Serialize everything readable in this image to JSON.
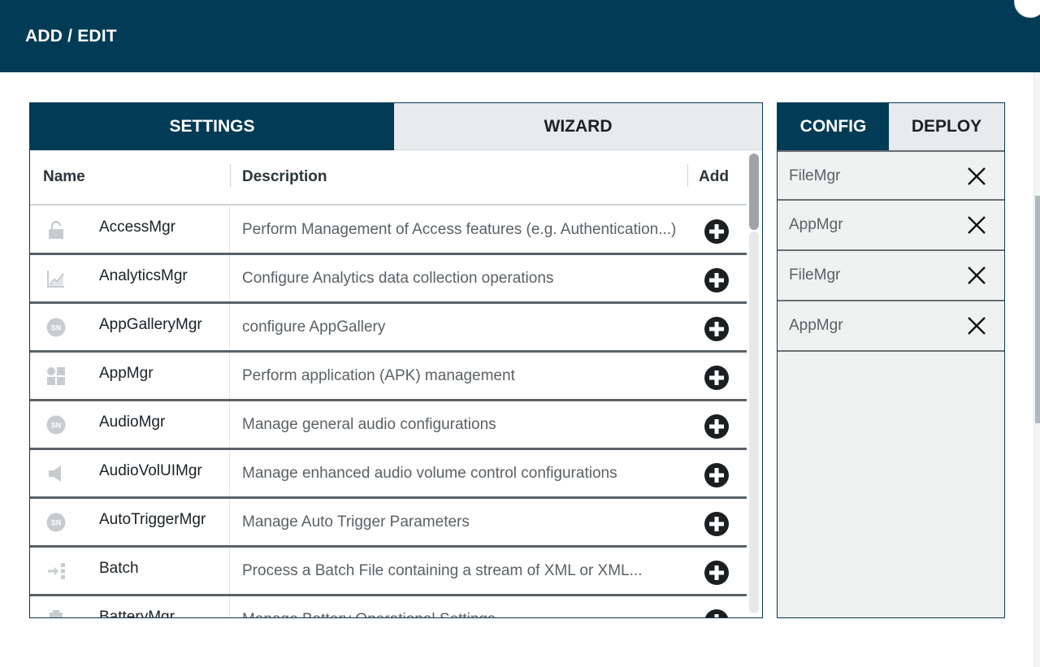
{
  "header": {
    "title": "ADD / EDIT"
  },
  "left_tabs": {
    "settings": "SETTINGS",
    "wizard": "WIZARD"
  },
  "columns": {
    "name": "Name",
    "description": "Description",
    "add": "Add"
  },
  "rows": [
    {
      "name": "AccessMgr",
      "description": "Perform Management of Access features (e.g. Authentication...)",
      "icon": "lock-icon"
    },
    {
      "name": "AnalyticsMgr",
      "description": "Configure Analytics data collection operations",
      "icon": "chart-icon"
    },
    {
      "name": "AppGalleryMgr",
      "description": "configure AppGallery",
      "icon": "sn-badge-icon"
    },
    {
      "name": "AppMgr",
      "description": "Perform application (APK) management",
      "icon": "apps-grid-icon"
    },
    {
      "name": "AudioMgr",
      "description": "Manage general audio configurations",
      "icon": "sn-badge-icon"
    },
    {
      "name": "AudioVolUIMgr",
      "description": "Manage enhanced audio volume control configurations",
      "icon": "speaker-icon"
    },
    {
      "name": "AutoTriggerMgr",
      "description": "Manage Auto Trigger Parameters",
      "icon": "sn-badge-icon"
    },
    {
      "name": "Batch",
      "description": "Process a Batch File containing a stream of XML or XML...",
      "icon": "batch-icon"
    },
    {
      "name": "BatteryMgr",
      "description": "Manage Battery Operational Settings",
      "icon": "battery-icon"
    }
  ],
  "right_tabs": {
    "config": "CONFIG",
    "deploy": "DEPLOY"
  },
  "config_items": [
    {
      "label": "FileMgr"
    },
    {
      "label": "AppMgr"
    },
    {
      "label": "FileMgr"
    },
    {
      "label": "AppMgr"
    }
  ],
  "colors": {
    "primary": "#023b55",
    "tab_inactive": "#e9eaeb",
    "panel_bg": "#f0f2f1"
  }
}
